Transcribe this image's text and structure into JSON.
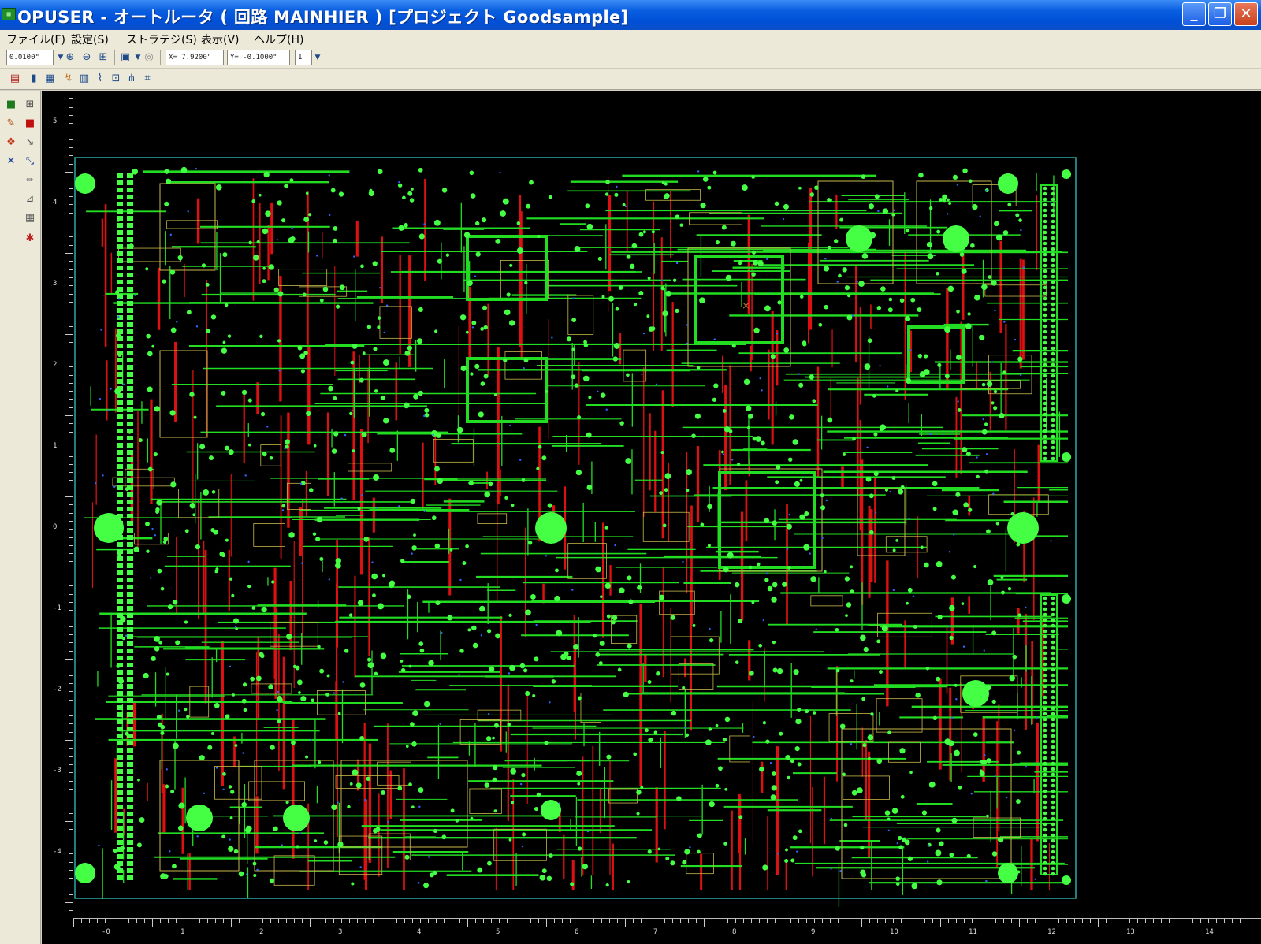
{
  "window": {
    "title": "OPUSER - オートルータ ( 回路 MAINHIER ) [プロジェクト Goodsample]",
    "app_icon": "pcb-app-icon",
    "controls": {
      "minimize": "_",
      "maximize": "❐",
      "close": "✕"
    }
  },
  "menubar": {
    "items": [
      {
        "label": "ファイル(F)"
      },
      {
        "label": "設定(S)"
      },
      {
        "label": "ストラテジ(S)"
      },
      {
        "label": "表示(V)"
      },
      {
        "label": "ヘルプ(H)"
      }
    ]
  },
  "toolbar": {
    "grid_value": "0.0100\"",
    "x_coord": "X= 7.9200\"",
    "y_coord": "Y= -0.1000\"",
    "layer_value": "1",
    "icons": [
      "zoom-in-icon",
      "zoom-out-icon",
      "zoom-fit-icon",
      "pan-icon",
      "select-icon",
      "snap-icon"
    ],
    "row2_icons": [
      "layer-icon",
      "pin-icon",
      "grid-icon",
      "route-icon",
      "net-icon",
      "trace-icon",
      "via-icon",
      "fanout-icon",
      "clean-icon"
    ]
  },
  "palette": {
    "icons": [
      "place-icon",
      "move-icon",
      "route-manual-icon",
      "delete-icon",
      "select-net-icon",
      "unroute-icon",
      "via-add-icon",
      "trace-edit-icon",
      "pencil-icon",
      "measure-icon",
      "report-icon",
      "drc-icon"
    ]
  },
  "rulers": {
    "vertical_labels": [
      "5",
      "4",
      "3",
      "2",
      "1",
      "0",
      "-1",
      "-2",
      "-3",
      "-4"
    ],
    "horizontal_labels": [
      "-0",
      "1",
      "2",
      "3",
      "4",
      "5",
      "6",
      "7",
      "8",
      "9",
      "10",
      "11",
      "12",
      "13",
      "14"
    ]
  },
  "board": {
    "outline_color": "#2aa8a8",
    "trace_color_top": "#22dd22",
    "trace_color_bottom": "#dd1111",
    "pad_color": "#44ff44",
    "silk_color": "#c8b84a",
    "via_color": "#3366ff"
  }
}
